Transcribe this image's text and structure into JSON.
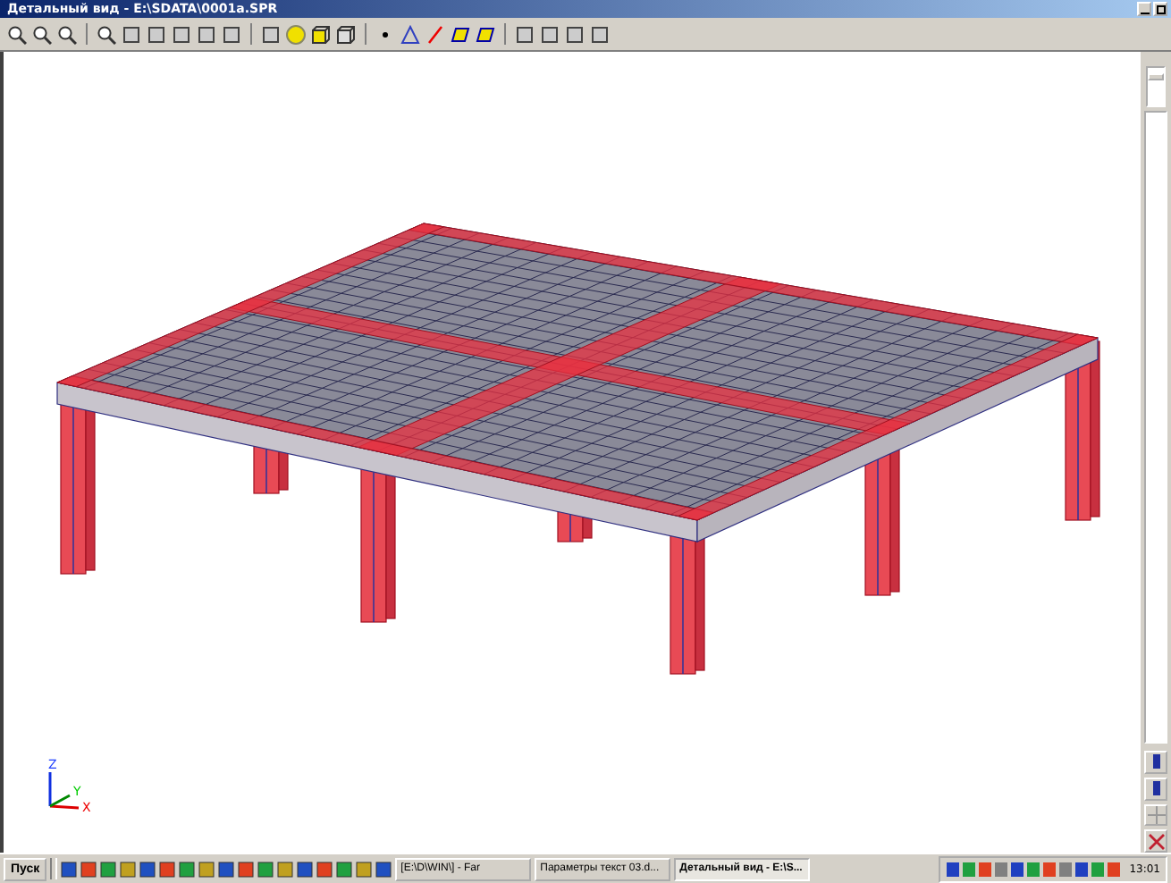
{
  "window": {
    "title": "Детальный вид - E:\\SDATA\\0001a.SPR"
  },
  "axes": {
    "z": "Z",
    "y": "Y",
    "x": "X"
  },
  "zoom_slider": {
    "level": 0.8
  },
  "taskbar": {
    "start": "Пуск",
    "tasks": [
      {
        "label": "[E:\\D\\WIN\\] - Far",
        "selected": false
      },
      {
        "label": "Параметры текст 03.d...",
        "selected": false
      },
      {
        "label": "Детальный вид - E:\\S...",
        "selected": true
      }
    ],
    "clock": "13:01"
  }
}
